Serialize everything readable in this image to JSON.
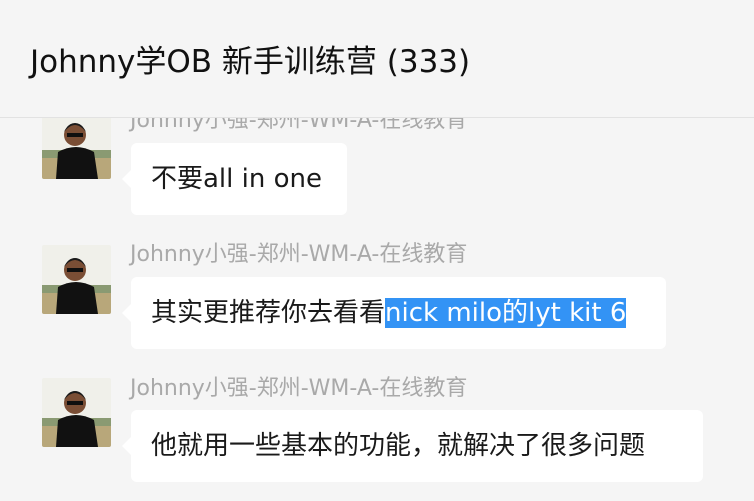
{
  "header": {
    "title": "Johnny学OB 新手训练营 (333)"
  },
  "messages": [
    {
      "sender": "Johnny小强-郑州-WM-A-在线教育",
      "text": "不要all in one",
      "highlight": ""
    },
    {
      "sender": "Johnny小强-郑州-WM-A-在线教育",
      "text": "其实更推荐你去看看",
      "highlight": "nick milo的lyt kit 6"
    },
    {
      "sender": "Johnny小强-郑州-WM-A-在线教育",
      "text": "他就用一些基本的功能，就解决了很多问题",
      "highlight": ""
    }
  ],
  "colors": {
    "selection": "#3393f5",
    "bubble": "#ffffff",
    "background": "#f5f5f5",
    "sender": "#a9a9a9"
  }
}
